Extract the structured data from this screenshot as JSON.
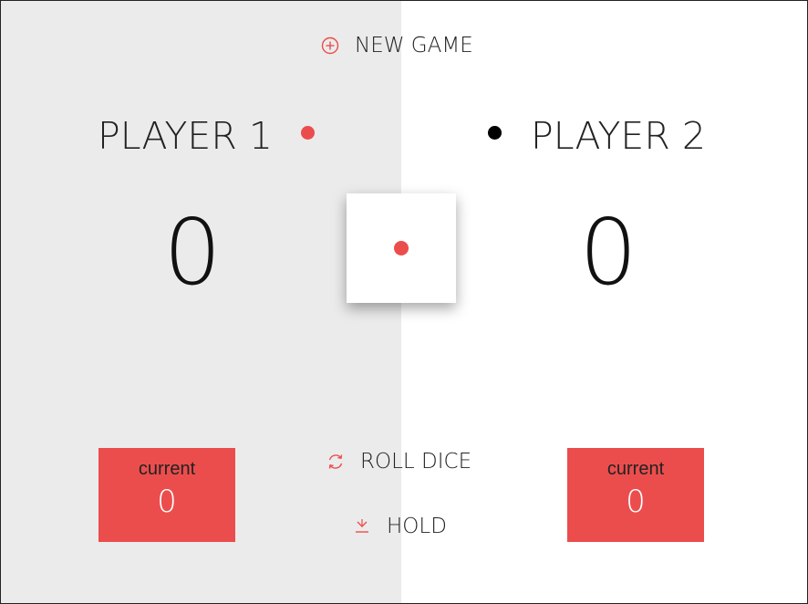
{
  "colors": {
    "accent": "#eb4d4d",
    "inactive_dot": "#000000",
    "left_panel_bg": "#ebebeb",
    "right_panel_bg": "#ffffff",
    "text": "#222222"
  },
  "buttons": {
    "new_game": {
      "label": "NEW GAME",
      "icon": "plus-circle-icon"
    },
    "roll_dice": {
      "label": "ROLL DICE",
      "icon": "refresh-icon"
    },
    "hold": {
      "label": "HOLD",
      "icon": "download-icon"
    }
  },
  "players": [
    {
      "name": "PLAYER 1",
      "score": "0",
      "current_label": "current",
      "current_value": "0",
      "active": true
    },
    {
      "name": "PLAYER 2",
      "score": "0",
      "current_label": "current",
      "current_value": "0",
      "active": false
    }
  ],
  "dice": {
    "value": 1
  }
}
